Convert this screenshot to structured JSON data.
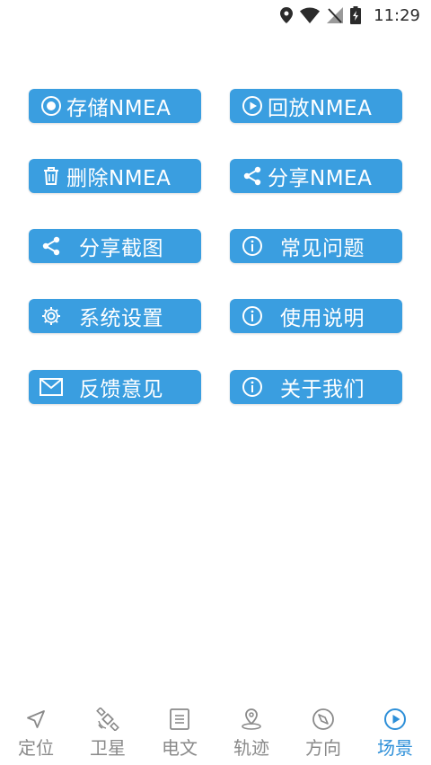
{
  "status": {
    "time": "11:29"
  },
  "buttons": {
    "save_nmea": "存储NMEA",
    "replay_nmea": "回放NMEA",
    "delete_nmea": "删除NMEA",
    "share_nmea": "分享NMEA",
    "share_screenshot": "分享截图",
    "faq": "常见问题",
    "settings": "系统设置",
    "instructions": "使用说明",
    "feedback": "反馈意见",
    "about": "关于我们"
  },
  "nav": {
    "items": [
      {
        "label": "定位",
        "icon": "navigation-arrow-icon"
      },
      {
        "label": "卫星",
        "icon": "satellite-icon"
      },
      {
        "label": "电文",
        "icon": "document-list-icon"
      },
      {
        "label": "轨迹",
        "icon": "location-pin-icon"
      },
      {
        "label": "方向",
        "icon": "compass-icon"
      },
      {
        "label": "场景",
        "icon": "play-circle-icon",
        "active": true
      }
    ]
  },
  "colors": {
    "button_bg": "#3a9ee0",
    "nav_active": "#2d8fd8",
    "nav_inactive": "#8a8a8a"
  }
}
